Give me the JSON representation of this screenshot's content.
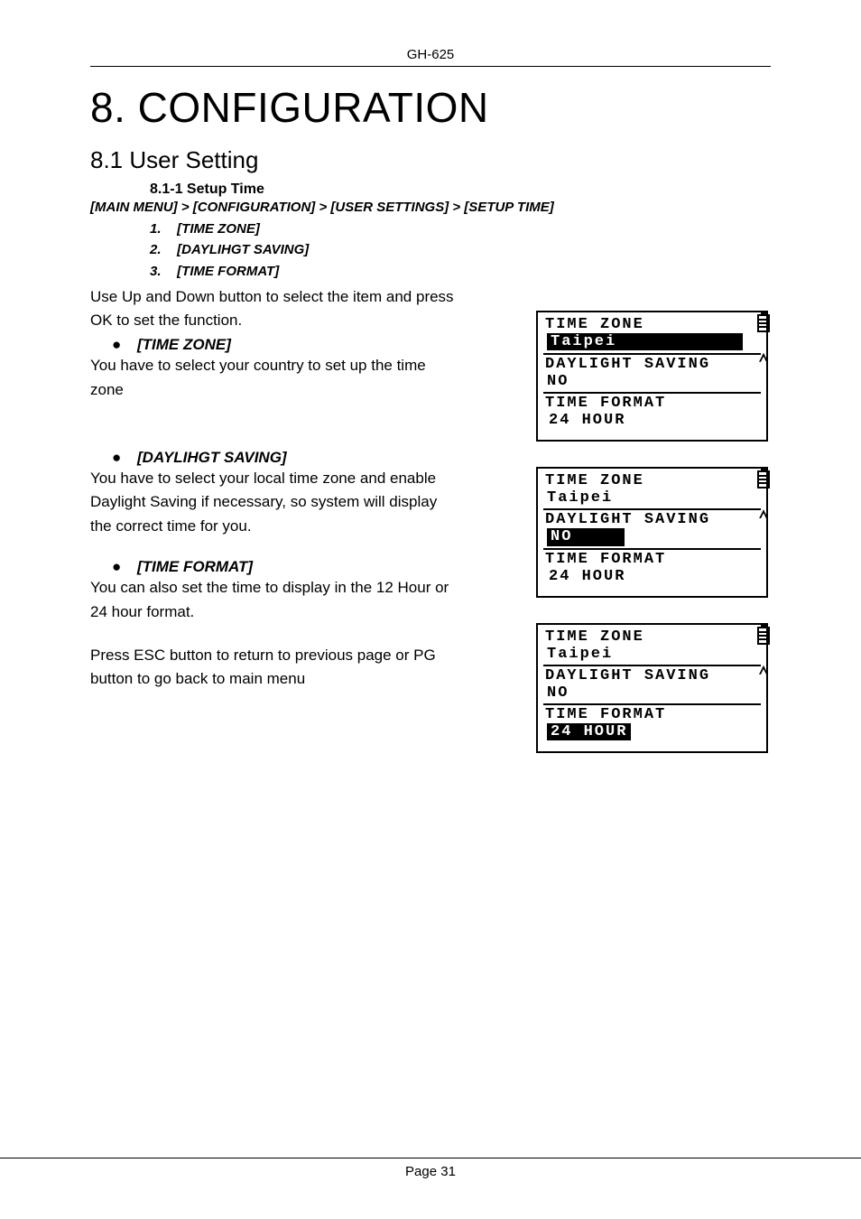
{
  "header": {
    "device": "GH-625"
  },
  "h1": "8. CONFIGURATION",
  "h2": "8.1 User Setting",
  "sub_heading": "8.1-1 Setup Time",
  "breadcrumb": "[MAIN MENU] > [CONFIGURATION] > [USER SETTINGS] > [SETUP TIME]",
  "ordered": [
    {
      "num": "1.",
      "label": "[TIME ZONE]"
    },
    {
      "num": "2.",
      "label": "[DAYLIHGT SAVING]"
    },
    {
      "num": "3.",
      "label": "[TIME FORMAT]"
    }
  ],
  "intro": "Use Up and Down button to select the item and press OK to set the function.",
  "sections": [
    {
      "bullet": "[TIME ZONE]",
      "body": "You have to select your country to set up the time zone"
    },
    {
      "bullet": "[DAYLIHGT SAVING]",
      "body": "You have to select your local time zone and enable Daylight Saving if necessary, so system will display the correct time for you."
    },
    {
      "bullet": "[TIME FORMAT]",
      "body": "You can also set the time to display in the 12 Hour or 24 hour format."
    }
  ],
  "outro": "Press ESC button to return to previous page or PG button to go back to main menu",
  "lcd": {
    "labels": {
      "tz": "TIME ZONE",
      "ds": "DAYLIGHT SAVING",
      "tf": "TIME FORMAT"
    },
    "values": {
      "tz": "Taipei",
      "ds": "NO",
      "tf": "24 HOUR"
    }
  },
  "footer": {
    "page": "Page 31"
  }
}
